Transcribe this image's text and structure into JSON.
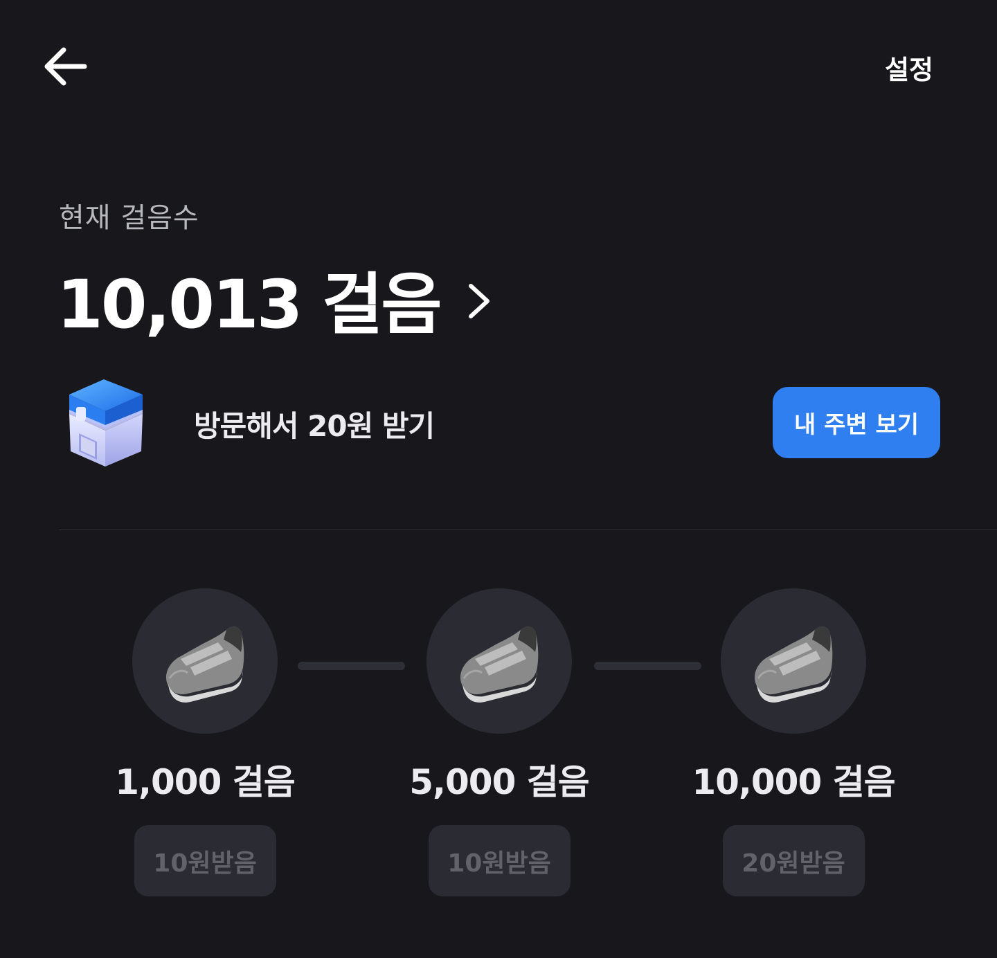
{
  "header": {
    "settings_label": "설정"
  },
  "steps": {
    "label": "현재 걸음수",
    "value": "10,013 걸음"
  },
  "visit": {
    "text": "방문해서 20원 받기",
    "button_label": "내 주변 보기"
  },
  "milestones": [
    {
      "label": "1,000 걸음",
      "reward": "10원받음"
    },
    {
      "label": "5,000 걸음",
      "reward": "10원받음"
    },
    {
      "label": "10,000 걸음",
      "reward": "20원받음"
    }
  ],
  "colors": {
    "background": "#18171c",
    "accent": "#2f7ff0",
    "disabled_text": "#626269",
    "card": "#2b2b33"
  },
  "icons": {
    "back": "arrow-left-icon",
    "chevron": "chevron-right-icon",
    "store": "store-icon",
    "shoe": "shoe-icon"
  }
}
